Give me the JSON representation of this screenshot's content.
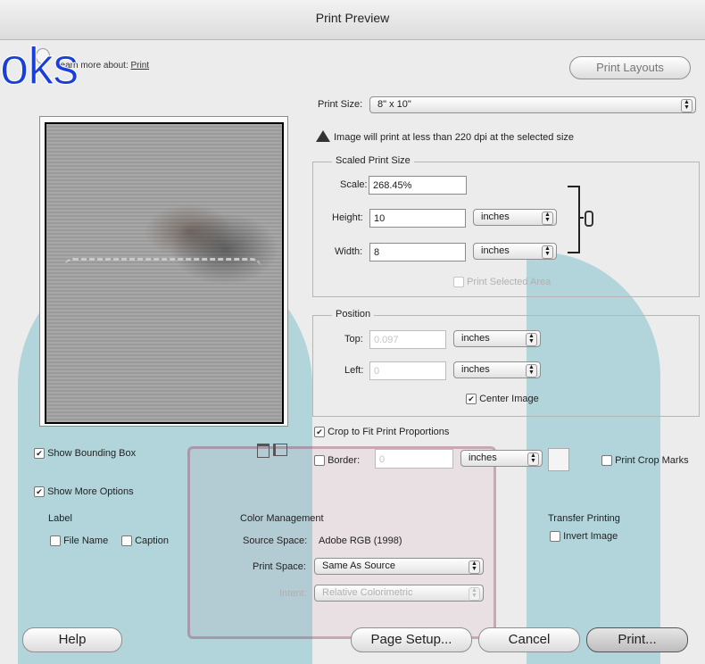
{
  "window": {
    "title": "Print Preview"
  },
  "watermark": {
    "text": "oks"
  },
  "learn_more": {
    "prefix": "Learn more about:",
    "link": "Print"
  },
  "print_layouts_button": "Print Layouts",
  "print_size": {
    "label": "Print Size:",
    "value": "8\" x 10\""
  },
  "warning": {
    "icon": "warning-triangle-icon",
    "text": "Image will print at less than 220 dpi at the selected size"
  },
  "scaled": {
    "legend": "Scaled Print Size",
    "scale_label": "Scale:",
    "scale_value": "268.45%",
    "height_label": "Height:",
    "height_value": "10",
    "height_unit": "inches",
    "width_label": "Width:",
    "width_value": "8",
    "width_unit": "inches",
    "print_selected": "Print Selected Area"
  },
  "position": {
    "legend": "Position",
    "top_label": "Top:",
    "top_value": "0.097",
    "top_unit": "inches",
    "left_label": "Left:",
    "left_value": "0",
    "left_unit": "inches",
    "center_image": "Center Image"
  },
  "crop_to_fit": "Crop to Fit Print Proportions",
  "border": {
    "label": "Border:",
    "value": "0",
    "unit": "inches"
  },
  "print_crop_marks": "Print Crop Marks",
  "show_bounding_box": "Show Bounding Box",
  "show_more_options": "Show More Options",
  "label_section": {
    "title": "Label",
    "file_name": "File Name",
    "caption": "Caption"
  },
  "color_mgmt": {
    "title": "Color Management",
    "source_label": "Source Space:",
    "source_value": "Adobe RGB (1998)",
    "print_space_label": "Print Space:",
    "print_space_value": "Same As Source",
    "intent_label": "Intent:",
    "intent_value": "Relative Colorimetric"
  },
  "transfer": {
    "title": "Transfer Printing",
    "invert": "Invert Image"
  },
  "buttons": {
    "help": "Help",
    "page_setup": "Page Setup...",
    "cancel": "Cancel",
    "print": "Print..."
  },
  "colors": {
    "accent_overlay": "#36a5b9",
    "watermark_blue": "#1a3ed8"
  }
}
